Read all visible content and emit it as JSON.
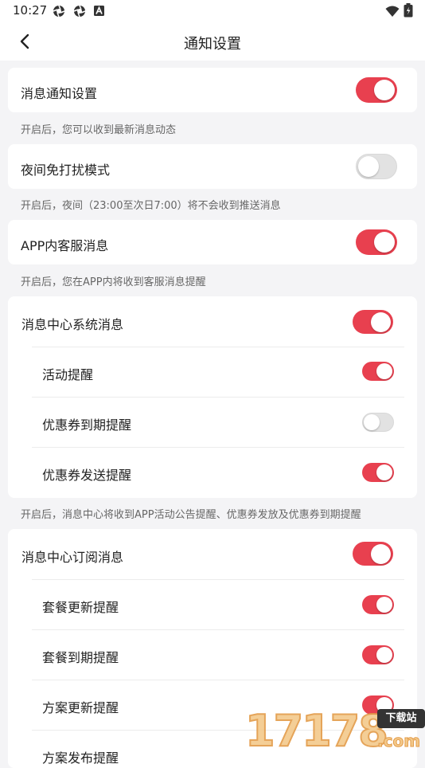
{
  "status_bar": {
    "time": "10:27",
    "left_icons": [
      "app-notification-icon",
      "app-notification-icon",
      "a-notification-icon"
    ],
    "right_icons": [
      "wifi-icon",
      "battery-icon"
    ]
  },
  "header": {
    "title": "通知设置",
    "back_icon": "chevron-left-icon"
  },
  "theme": {
    "accent": "#e8404f",
    "toggle_off": "#e2e2e2",
    "background": "#f4f4f6"
  },
  "sections": [
    {
      "items": [
        {
          "label": "消息通知设置",
          "on": true
        }
      ],
      "note": "开启后，您可以收到最新消息动态"
    },
    {
      "items": [
        {
          "label": "夜间免打扰模式",
          "on": false
        }
      ],
      "note": "开启后，夜间（23:00至次日7:00）将不会收到推送消息"
    },
    {
      "items": [
        {
          "label": "APP内客服消息",
          "on": true
        }
      ],
      "note": "开启后，您在APP内将收到客服消息提醒"
    },
    {
      "items": [
        {
          "label": "消息中心系统消息",
          "on": true
        },
        {
          "label": "活动提醒",
          "on": true
        },
        {
          "label": "优惠券到期提醒",
          "on": false
        },
        {
          "label": "优惠券发送提醒",
          "on": true
        }
      ],
      "note": "开启后，消息中心将收到APP活动公告提醒、优惠券发放及优惠券到期提醒"
    },
    {
      "items": [
        {
          "label": "消息中心订阅消息",
          "on": true
        },
        {
          "label": "套餐更新提醒",
          "on": true
        },
        {
          "label": "套餐到期提醒",
          "on": true
        },
        {
          "label": "方案更新提醒",
          "on": true
        },
        {
          "label": "方案发布提醒",
          "on": true
        }
      ]
    }
  ],
  "watermark": {
    "digits": "17178",
    "tag": "下载站",
    "suffix": ".com"
  }
}
